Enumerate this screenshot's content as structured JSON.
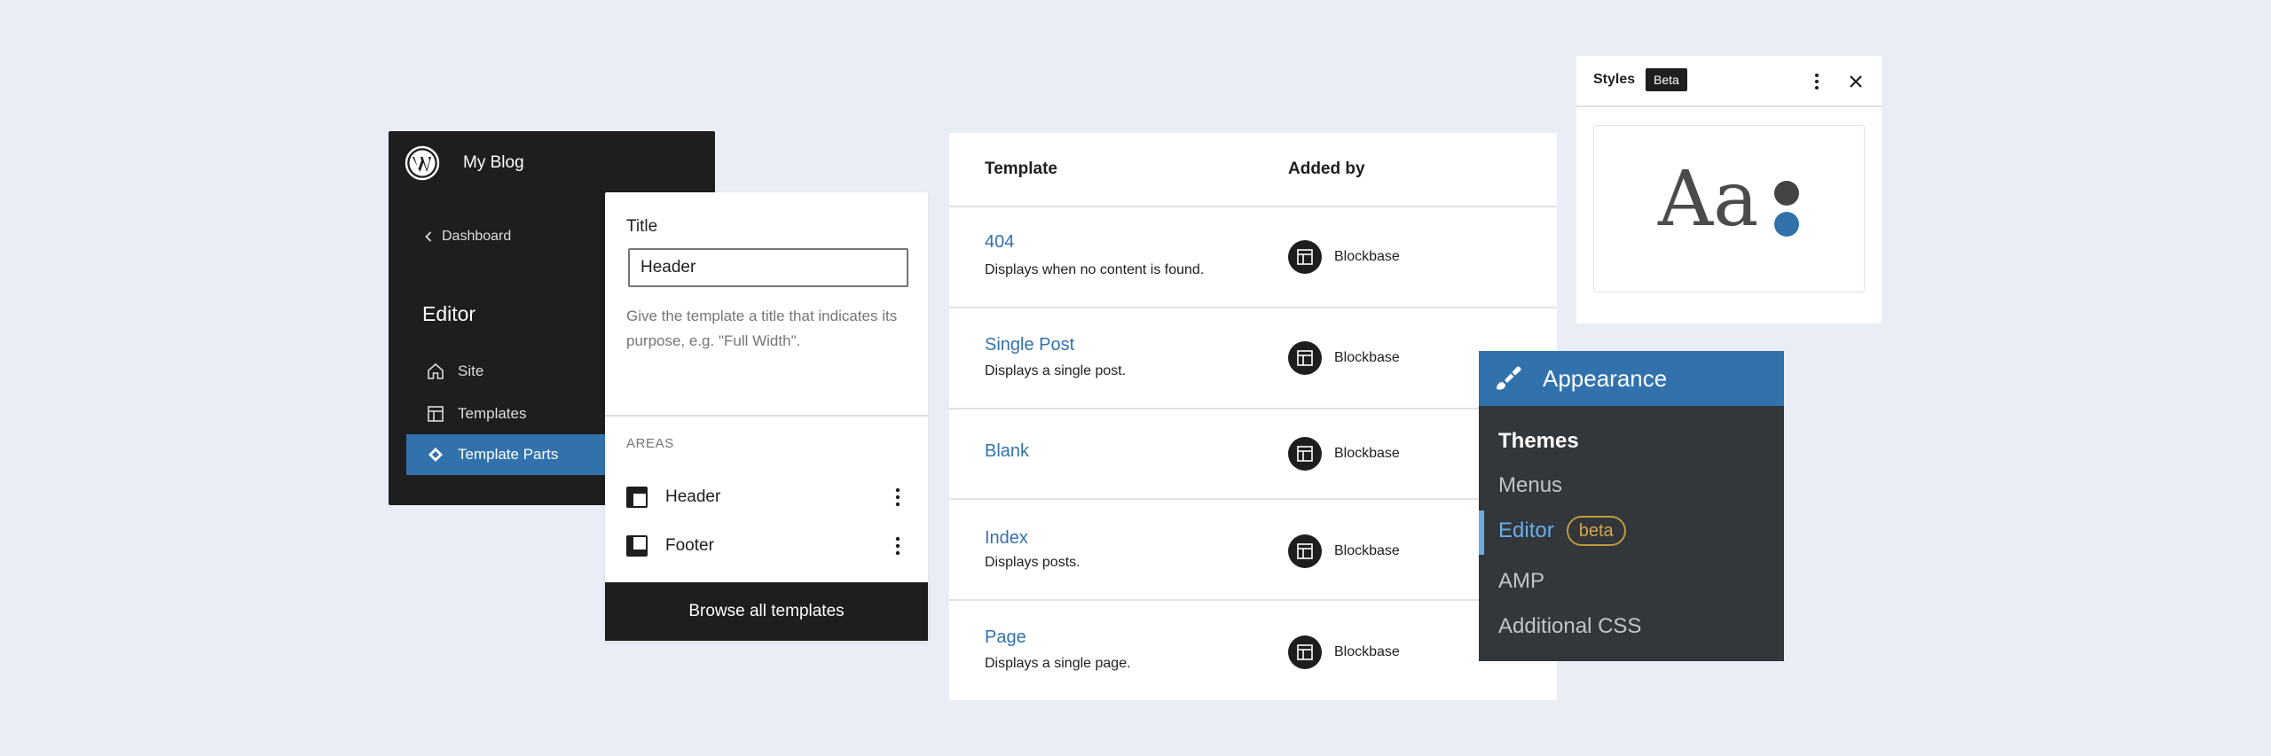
{
  "editor_sidebar": {
    "site_name": "My Blog",
    "back_label": "Dashboard",
    "title": "Editor",
    "items": [
      {
        "label": "Site",
        "icon": "home-icon"
      },
      {
        "label": "Templates",
        "icon": "layout-icon"
      },
      {
        "label": "Template Parts",
        "icon": "symbol-icon",
        "active": true
      }
    ]
  },
  "template_part": {
    "title_label": "Title",
    "title_value": "Header",
    "help": "Give the template a title that indicates its purpose, e.g. \"Full Width\".",
    "areas_heading": "AREAS",
    "areas": [
      {
        "label": "Header",
        "icon": "header-icon"
      },
      {
        "label": "Footer",
        "icon": "footer-icon"
      }
    ],
    "browse_label": "Browse all templates"
  },
  "templates_table": {
    "columns": [
      "Template",
      "Added by"
    ],
    "rows": [
      {
        "name": "404",
        "description": "Displays when no content is found.",
        "author": "Blockbase"
      },
      {
        "name": "Single Post",
        "description": "Displays a single post.",
        "author": "Blockbase"
      },
      {
        "name": "Blank",
        "description": "",
        "author": "Blockbase"
      },
      {
        "name": "Index",
        "description": "Displays posts.",
        "author": "Blockbase"
      },
      {
        "name": "Page",
        "description": "Displays a single page.",
        "author": "Blockbase"
      }
    ]
  },
  "styles_panel": {
    "title": "Styles",
    "badge": "Beta",
    "preview_text": "Aa",
    "colors": [
      "#444444",
      "#3172ad"
    ]
  },
  "appearance_menu": {
    "title": "Appearance",
    "items": [
      {
        "label": "Themes",
        "current": true
      },
      {
        "label": "Menus"
      },
      {
        "label": "Editor",
        "badge": "beta",
        "highlighted": true
      },
      {
        "label": "AMP"
      },
      {
        "label": "Additional CSS"
      }
    ]
  },
  "colors": {
    "background": "#e9eef6",
    "accent": "#3172ad",
    "dark": "#1e1e1e",
    "admin_menu": "#32373c",
    "beta_pill": "#c29b3c"
  }
}
